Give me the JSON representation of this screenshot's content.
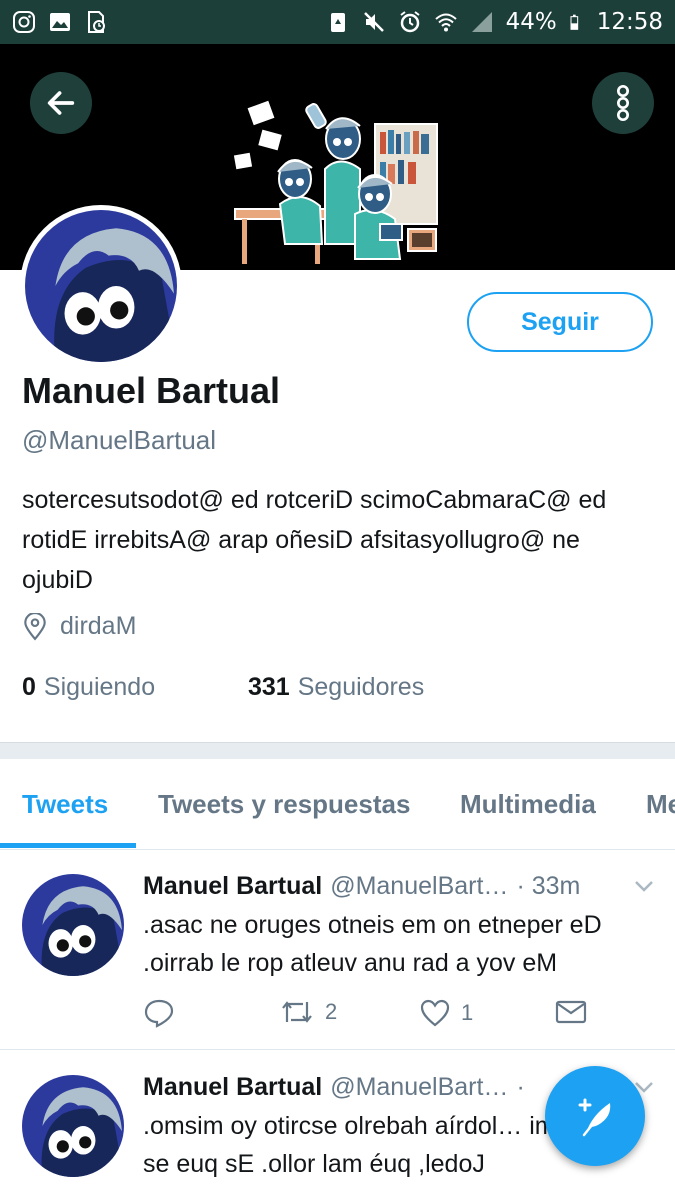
{
  "status_bar": {
    "battery": "44%",
    "time": "12:58",
    "left_icons": [
      "instagram-icon",
      "gallery-icon",
      "file-clock-icon"
    ],
    "right_icons": [
      "recycle-icon",
      "mute-icon",
      "alarm-icon",
      "wifi-icon",
      "signal-icon",
      "battery-icon"
    ]
  },
  "profile": {
    "name": "Manuel Bartual",
    "handle": "@ManuelBartual",
    "bio": "sotercesutsodot@ ed rotceriD scimoCabmaraC@ ed rotidE irrebitsA@ arap oñesiD afsitasyollugro@ ne ojubiD",
    "location": "dirdaM",
    "follow_label": "Seguir",
    "following_count": "0",
    "following_label": "Siguiendo",
    "followers_count": "331",
    "followers_label": "Seguidores"
  },
  "tabs": [
    {
      "label": "Tweets",
      "active": true
    },
    {
      "label": "Tweets y respuestas",
      "active": false
    },
    {
      "label": "Multimedia",
      "active": false
    },
    {
      "label": "Me",
      "active": false
    }
  ],
  "tweets": [
    {
      "name": "Manuel Bartual",
      "handle": "@ManuelBart…",
      "time": "· 33m",
      "text": ".asac ne oruges otneis em on etneper eD .oirrab le rop atleuv anu rad a yov eM",
      "replies": "",
      "retweets": "2",
      "likes": "1"
    },
    {
      "name": "Manuel Bartual",
      "handle": "@ManuelBart…",
      "time": "·",
      "text": ".omsim oy otircse olrebah aírdol… im atsah se euq sE .ollor lam éuq ,ledoJ"
    }
  ],
  "colors": {
    "accent": "#1da1f2",
    "status_bar": "#1c3f3a",
    "secondary_text": "#657786"
  }
}
